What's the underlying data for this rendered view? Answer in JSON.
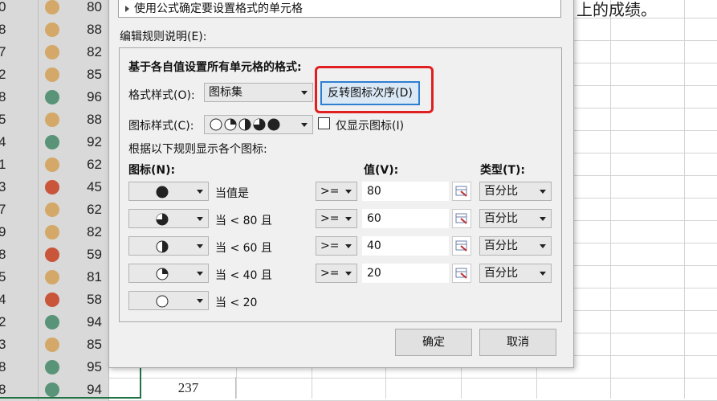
{
  "spreadsheet": {
    "rows": [
      {
        "left": "0",
        "score": "80",
        "color": "#d4a868"
      },
      {
        "left": "8",
        "score": "88",
        "color": "#d4a868"
      },
      {
        "left": "7",
        "score": "82",
        "color": "#d4a868"
      },
      {
        "left": "2",
        "score": "85",
        "color": "#d4a868"
      },
      {
        "left": "8",
        "score": "96",
        "color": "#5a9478"
      },
      {
        "left": "5",
        "score": "88",
        "color": "#d4a868"
      },
      {
        "left": "4",
        "score": "92",
        "color": "#5a9478"
      },
      {
        "left": "1",
        "score": "62",
        "color": "#d4a868"
      },
      {
        "left": "3",
        "score": "45",
        "color": "#c9553a"
      },
      {
        "left": "7",
        "score": "62",
        "color": "#d4a868"
      },
      {
        "left": "9",
        "score": "82",
        "color": "#d4a868"
      },
      {
        "left": "8",
        "score": "59",
        "color": "#c9553a"
      },
      {
        "left": "5",
        "score": "81",
        "color": "#d4a868"
      },
      {
        "left": "4",
        "score": "58",
        "color": "#c9553a"
      },
      {
        "left": "2",
        "score": "94",
        "color": "#5a9478"
      },
      {
        "left": "3",
        "score": "85",
        "color": "#d4a868"
      },
      {
        "left": "8",
        "score": "95",
        "color": "#5a9478"
      },
      {
        "left": "8",
        "score": "94",
        "color": "#5a9478"
      }
    ],
    "total_value": "237",
    "partial_text": "上的成绩。"
  },
  "dialog": {
    "rule_type_item": "使用公式确定要设置格式的单元格",
    "edit_rule_label": "编辑规则说明(E):",
    "section_title": "基于各自值设置所有单元格的格式:",
    "format_style_label": "格式样式(O):",
    "format_style_value": "图标集",
    "reverse_button": "反转图标次序(D)",
    "icon_style_label": "图标样式(C):",
    "show_icon_only_label": "仅显示图标(I)",
    "rules_caption": "根据以下规则显示各个图标:",
    "col_icon": "图标(N):",
    "col_value": "值(V):",
    "col_type": "类型(T):",
    "rules": [
      {
        "icon": "full",
        "condition": "当值是",
        "operator": ">=",
        "value": "80",
        "type": "百分比"
      },
      {
        "icon": "three-quarter",
        "condition": "当 < 80 且",
        "operator": ">=",
        "value": "60",
        "type": "百分比"
      },
      {
        "icon": "half",
        "condition": "当 < 60 且",
        "operator": ">=",
        "value": "40",
        "type": "百分比"
      },
      {
        "icon": "quarter",
        "condition": "当 < 40 且",
        "operator": ">=",
        "value": "20",
        "type": "百分比"
      },
      {
        "icon": "empty",
        "condition": "当 < 20"
      }
    ],
    "ok_button": "确定",
    "cancel_button": "取消",
    "highlight_color": "#e02020",
    "accent_color": "#2f7fd0"
  }
}
